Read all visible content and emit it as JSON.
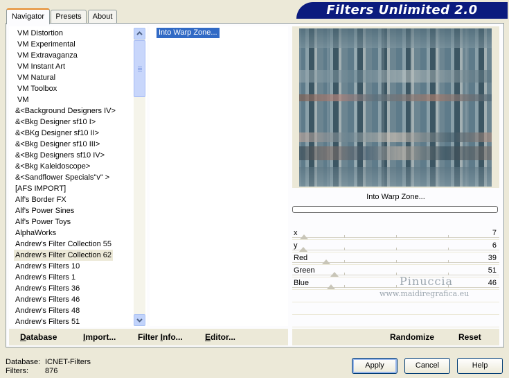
{
  "tabs": [
    {
      "label": "Navigator",
      "active": true
    },
    {
      "label": "Presets",
      "active": false
    },
    {
      "label": "About",
      "active": false
    }
  ],
  "banner": {
    "title": "Filters Unlimited 2.0"
  },
  "categories": {
    "items": [
      "VM Distortion",
      "VM Experimental",
      "VM Extravaganza",
      "VM Instant Art",
      "VM Natural",
      "VM Toolbox",
      "VM",
      "&<Background Designers IV>",
      "&<Bkg Designer sf10 I>",
      "&<BKg Designer sf10 II>",
      "&<Bkg Designer sf10 III>",
      "&<Bkg Designers sf10 IV>",
      "&<Bkg Kaleidoscope>",
      "&<Sandflower Specials\"v\" >",
      "[AFS IMPORT]",
      "Alf's Border FX",
      "Alf's Power Sines",
      "Alf's Power Toys",
      "AlphaWorks",
      "Andrew's Filter Collection 55",
      "Andrew's Filter Collection 62",
      "Andrew's Filters 10",
      "Andrew's Filters 1",
      "Andrew's Filters 36",
      "Andrew's Filters 46",
      "Andrew's Filters 48",
      "Andrew's Filters 51"
    ],
    "selected_index": 20
  },
  "filters": {
    "items": [
      "Into Warp Zone..."
    ],
    "selected_index": 0
  },
  "preview": {
    "filter_name": "Into Warp Zone..."
  },
  "controls": [
    {
      "label": "x",
      "value": "7",
      "fraction": 0.027
    },
    {
      "label": "y",
      "value": "6",
      "fraction": 0.023
    },
    {
      "label": "Red",
      "value": "39",
      "fraction": 0.153
    },
    {
      "label": "Green",
      "value": "51",
      "fraction": 0.2
    },
    {
      "label": "Blue",
      "value": "46",
      "fraction": 0.18
    }
  ],
  "watermark": {
    "name": "Pinuccia",
    "url": "www.maidiregrafica.eu"
  },
  "link_buttons": {
    "database": {
      "first": "D",
      "rest": "atabase"
    },
    "import": {
      "first": "I",
      "rest": "mport..."
    },
    "filter_info": {
      "pre": "Filter ",
      "first": "I",
      "rest": "nfo..."
    },
    "editor": {
      "first": "E",
      "rest": "ditor..."
    },
    "randomize": "Randomize",
    "reset": "Reset"
  },
  "footer": {
    "database_label": "Database:",
    "database_value": "ICNET-Filters",
    "filters_label": "Filters:",
    "filters_value": "876"
  },
  "buttons": {
    "apply": "Apply",
    "cancel": "Cancel",
    "help": "Help"
  },
  "colors": {
    "selection": "#316ac5",
    "banner": "#0b1b7e",
    "tab_accent": "#e68b2c"
  }
}
